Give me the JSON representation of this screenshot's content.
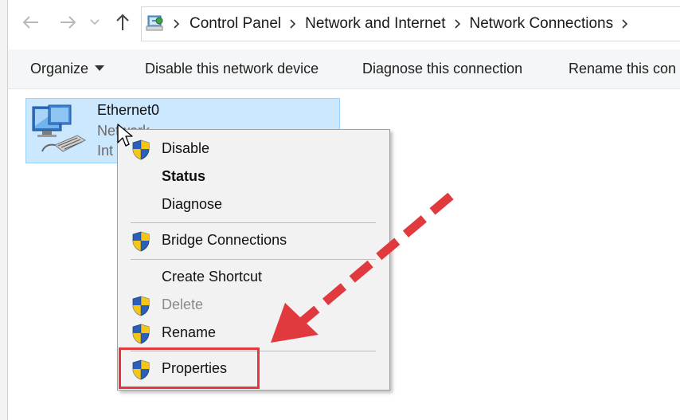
{
  "address_bar": {
    "breadcrumbs": [
      "Control Panel",
      "Network and Internet",
      "Network Connections"
    ]
  },
  "toolbar": {
    "organize_label": "Organize",
    "disable_label": "Disable this network device",
    "diagnose_label": "Diagnose this connection",
    "rename_label": "Rename this con"
  },
  "connection": {
    "name": "Ethernet0",
    "line2": "Network",
    "line3": "Int"
  },
  "context_menu": {
    "items": [
      {
        "label": "Disable",
        "shield": true
      },
      {
        "label": "Status",
        "bold": true
      },
      {
        "label": "Diagnose"
      },
      {
        "label": "Bridge Connections",
        "shield": true
      },
      {
        "label": "Create Shortcut"
      },
      {
        "label": "Delete",
        "shield": true,
        "disabled": true
      },
      {
        "label": "Rename",
        "shield": true
      },
      {
        "label": "Properties",
        "shield": true
      }
    ]
  },
  "colors": {
    "annotation_red": "#e03a3e",
    "selection_fill": "#cce8ff",
    "shield_blue": "#2b5fb8",
    "shield_yellow": "#f5c518"
  },
  "icons": [
    "back-arrow-icon",
    "forward-arrow-icon",
    "chevron-down-icon",
    "up-arrow-icon",
    "control-panel-icon",
    "network-adapter-icon",
    "uac-shield-icon",
    "mouse-cursor-icon"
  ]
}
